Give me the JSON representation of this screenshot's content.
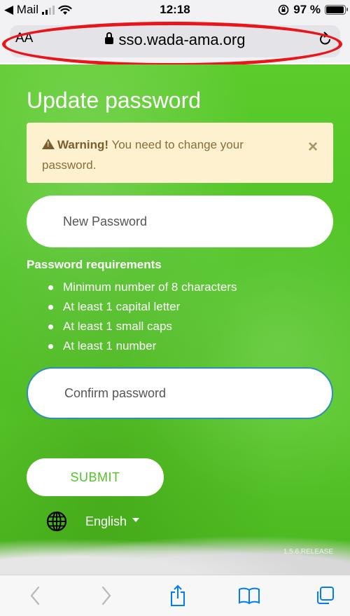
{
  "status_bar": {
    "back_app": "◀ Mail",
    "time": "12:18",
    "battery": "97 %"
  },
  "browser": {
    "text_size_label": "AA",
    "url": "sso.wada-ama.org",
    "accent_color": "#007aff"
  },
  "page": {
    "title": "Update password",
    "alert": {
      "strong": "Warning!",
      "message": " You need to change your password.",
      "close": "×"
    },
    "new_password_placeholder": "New Password",
    "requirements_title": "Password requirements",
    "requirements": [
      "Minimum number of 8 characters",
      "At least 1 capital letter",
      "At least 1 small caps",
      "At least 1 number"
    ],
    "confirm_password_placeholder": "Confirm password",
    "submit_label": "SUBMIT",
    "language": "English",
    "version": "1.5.6.RELEASE",
    "brand_color": "#53c425",
    "alert_bg_color": "#fdf1cf"
  },
  "icons": {
    "back": "chevron-left-icon",
    "forward": "chevron-right-icon",
    "share": "share-icon",
    "bookmarks": "book-icon",
    "tabs": "tabs-icon",
    "language": "globe-icon",
    "warning": "warning-icon",
    "reload": "reload-icon",
    "lock": "lock-icon"
  }
}
